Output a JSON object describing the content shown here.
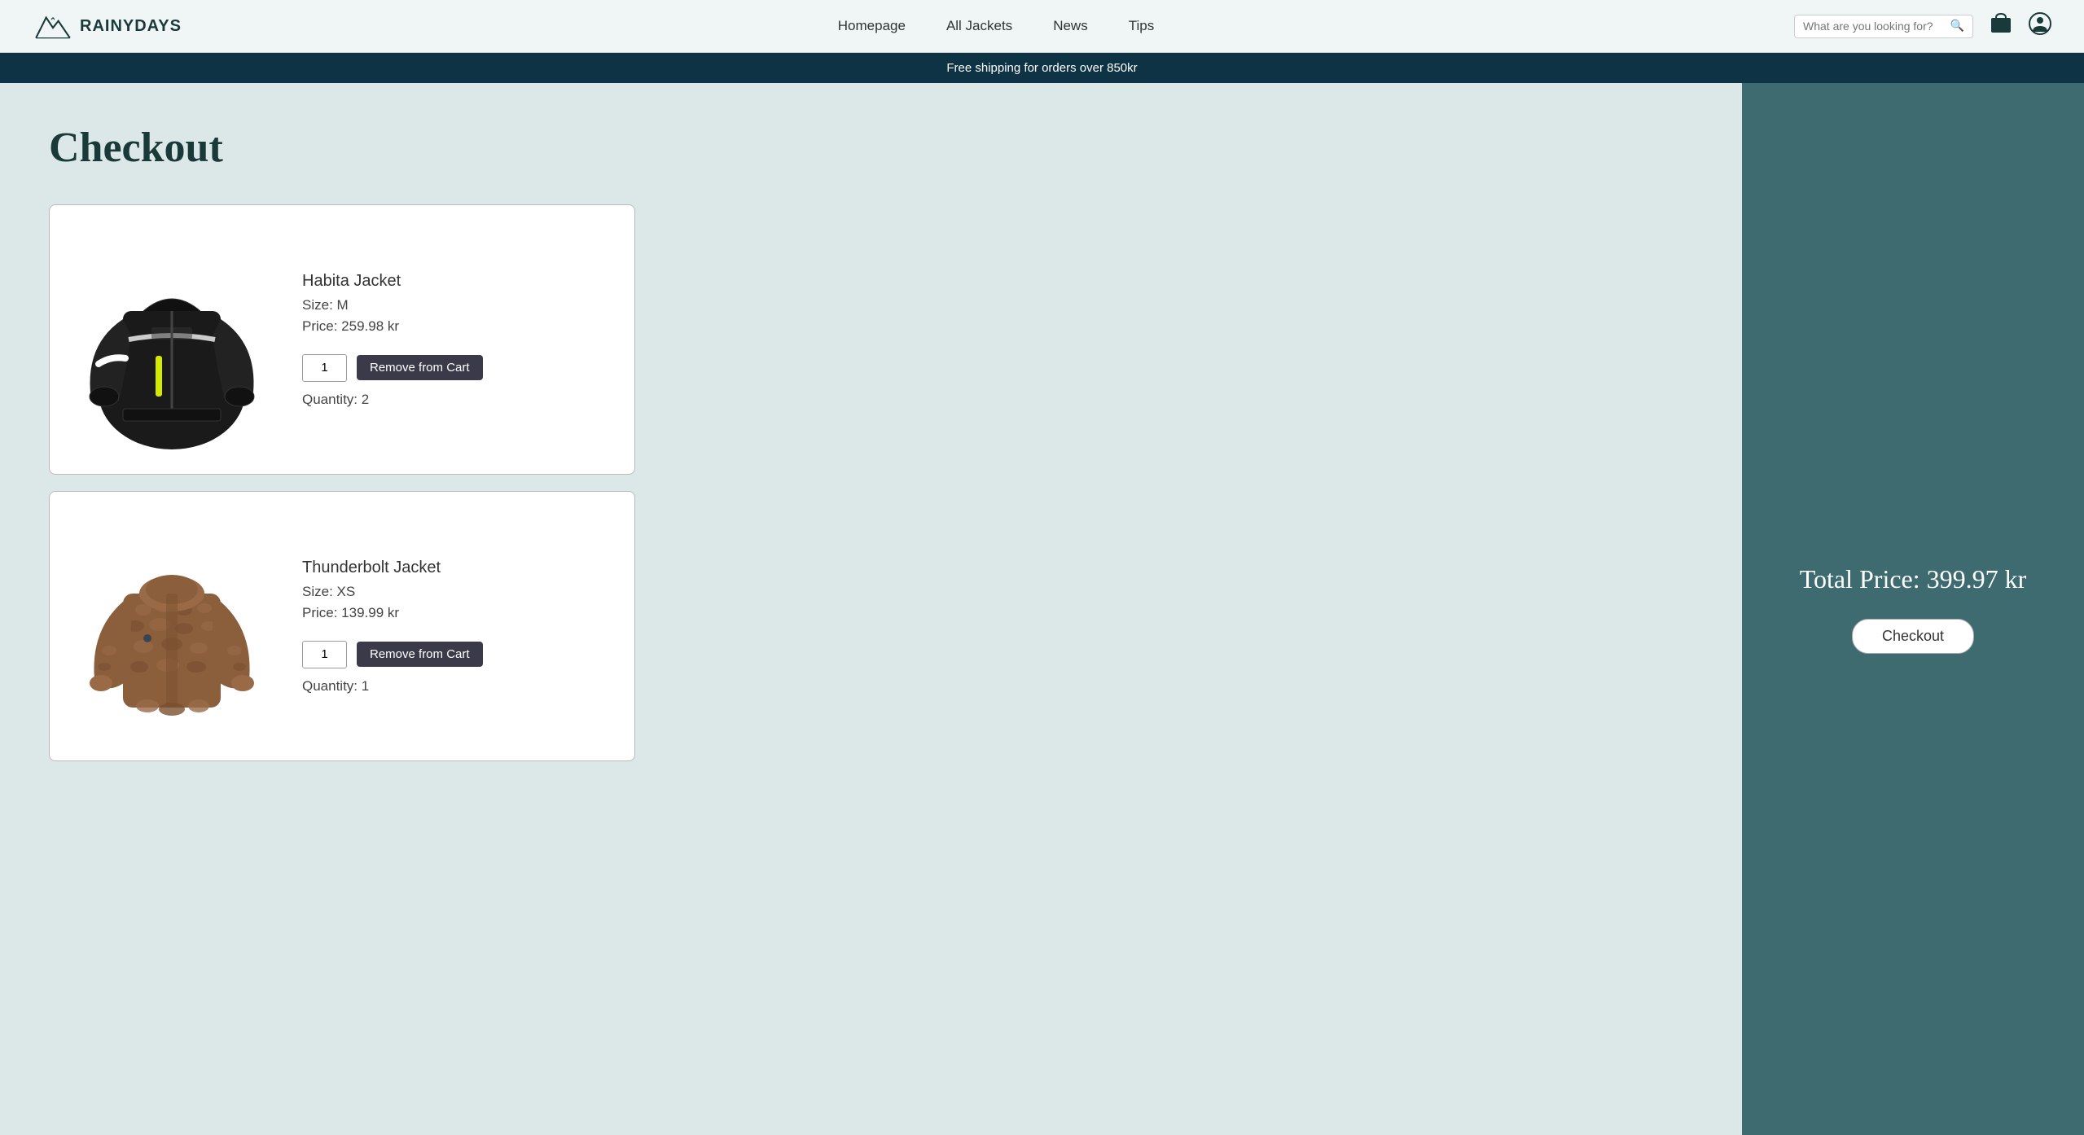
{
  "site": {
    "logo_text": "RAINYDAYS"
  },
  "nav": {
    "items": [
      {
        "label": "Homepage",
        "id": "homepage"
      },
      {
        "label": "All Jackets",
        "id": "all-jackets"
      },
      {
        "label": "News",
        "id": "news"
      },
      {
        "label": "Tips",
        "id": "tips"
      }
    ]
  },
  "search": {
    "placeholder": "What are you looking for?"
  },
  "shipping_banner": "Free shipping for orders over 850kr",
  "page_title": "Checkout",
  "cart_items": [
    {
      "id": "item-1",
      "name": "Habita Jacket",
      "size": "Size: M",
      "price": "Price: 259.98 kr",
      "quantity_label": "Quantity: 2",
      "quantity_value": "1",
      "remove_label": "Remove from Cart"
    },
    {
      "id": "item-2",
      "name": "Thunderbolt Jacket",
      "size": "Size: XS",
      "price": "Price: 139.99 kr",
      "quantity_label": "Quantity: 1",
      "quantity_value": "1",
      "remove_label": "Remove from Cart"
    }
  ],
  "sidebar": {
    "total_price": "Total Price: 399.97 kr",
    "checkout_label": "Checkout"
  }
}
